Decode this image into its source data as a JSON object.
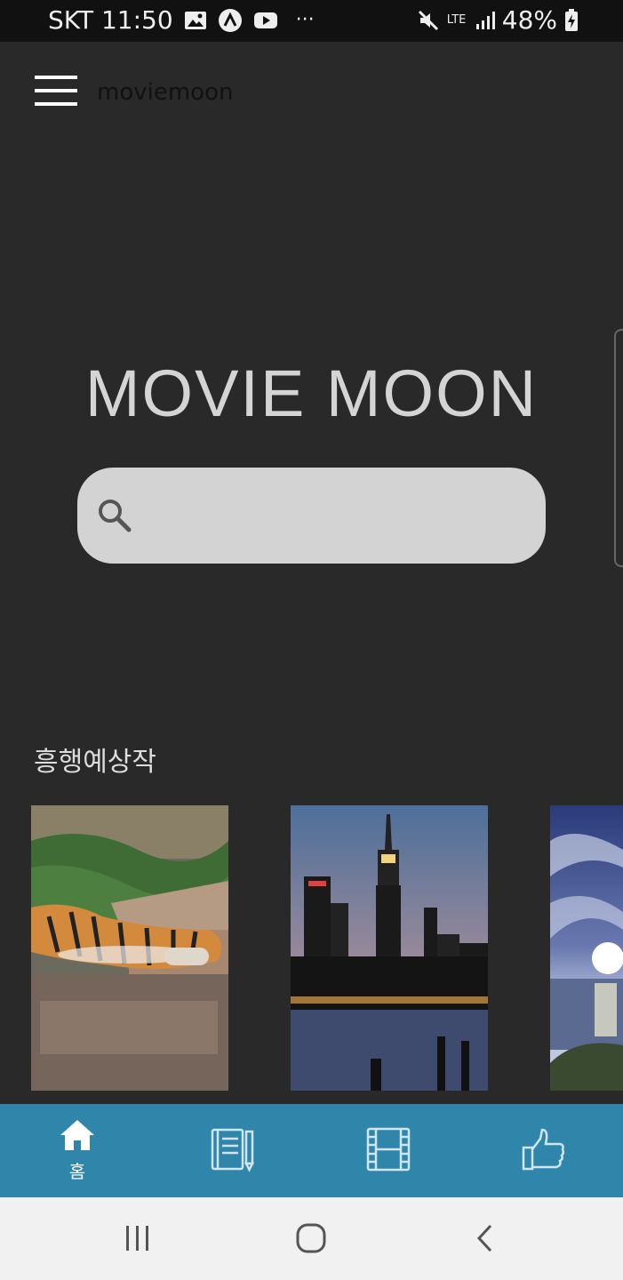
{
  "status_bar": {
    "carrier_time": "SKT 11:50",
    "more": "···",
    "network": "LTE",
    "battery": "48%"
  },
  "app_bar": {
    "title": "moviemoon"
  },
  "hero": {
    "title": "MOVIE MOON",
    "search_placeholder": ""
  },
  "section": {
    "title": "흥행예상작",
    "posters": [
      {
        "subject": "tiger resting on stone ledge"
      },
      {
        "subject": "city skyline at dusk over water"
      },
      {
        "subject": "sunset over sea with clouds"
      }
    ]
  },
  "bottom_nav": {
    "items": [
      {
        "label": "홈",
        "icon": "home-icon",
        "active": true
      },
      {
        "label": "",
        "icon": "notebook-icon",
        "active": false
      },
      {
        "label": "",
        "icon": "film-icon",
        "active": false
      },
      {
        "label": "",
        "icon": "thumbs-up-icon",
        "active": false
      }
    ]
  },
  "colors": {
    "background": "#292929",
    "nav": "#2f86aa",
    "search": "#d3d3d3"
  }
}
